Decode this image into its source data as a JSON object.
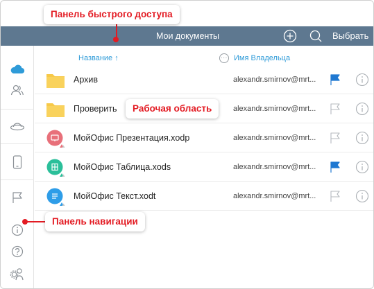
{
  "app": {
    "title": "Мои документы",
    "select_label": "Выбрать"
  },
  "columns": {
    "name_label": "Название ↑",
    "owner_label": "Имя Владельца",
    "more_label": "···"
  },
  "files": [
    {
      "name": "Архив",
      "owner": "alexandr.smirnov@mrt...",
      "type": "folder",
      "flagged": true
    },
    {
      "name": "Проверить",
      "owner": "alexandr.smirnov@mrt...",
      "type": "folder",
      "flagged": false
    },
    {
      "name": "МойОфис Презентация.xodp",
      "owner": "alexandr.smirnov@mrt...",
      "type": "presentation",
      "flagged": false
    },
    {
      "name": "МойОфис Таблица.xods",
      "owner": "alexandr.smirnov@mrt...",
      "type": "spreadsheet",
      "flagged": true
    },
    {
      "name": "МойОфис Текст.xodt",
      "owner": "alexandr.smirnov@mrt...",
      "type": "text",
      "flagged": false
    }
  ],
  "callouts": {
    "quick_access": "Панель быстрого доступа",
    "workspace": "Рабочая область",
    "navigation": "Панель навигации"
  },
  "sidebar_icons": [
    "cloud-icon",
    "users-icon",
    "saucer-icon",
    "tablet-icon",
    "flag-icon",
    "info-icon",
    "help-icon",
    "user-settings-icon"
  ],
  "colors": {
    "topbar": "#5e7890",
    "accent_blue": "#2f9bd8",
    "flag_blue": "#1f78d1",
    "callout_red": "#e31b23",
    "folder_yellow": "#f7c948",
    "presentation_red": "#e8707a",
    "spreadsheet_green": "#2bbf9a",
    "text_blue": "#2e9de8"
  }
}
